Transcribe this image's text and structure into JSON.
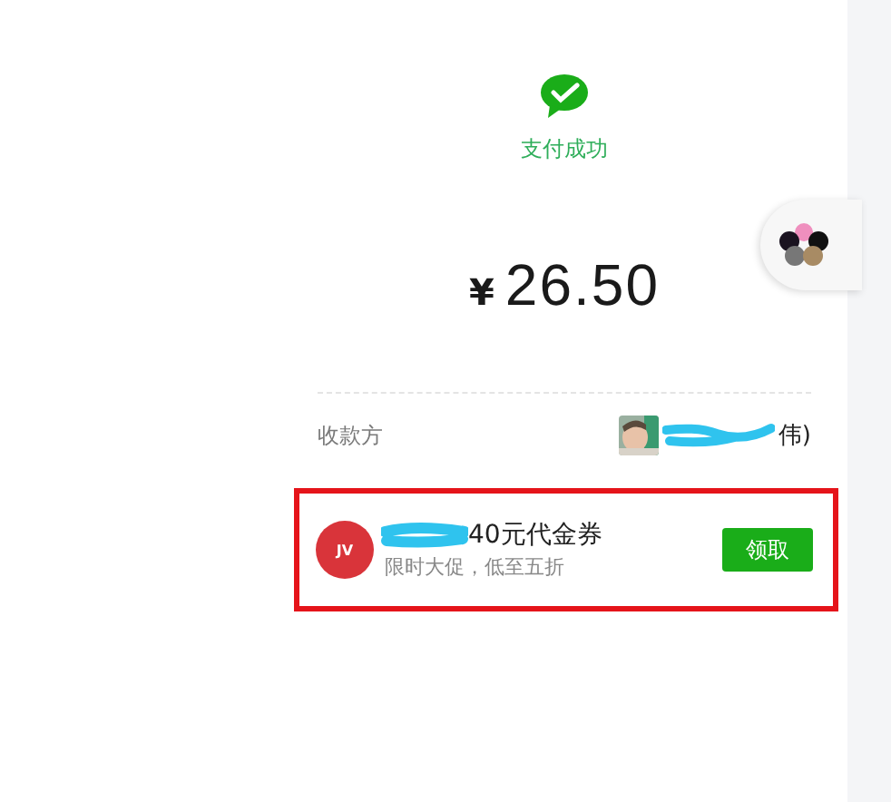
{
  "status": {
    "title": "支付成功"
  },
  "amount": {
    "currency": "¥",
    "value": "26.50"
  },
  "payee": {
    "label": "收款方",
    "name": "伟)"
  },
  "coupon": {
    "logo_text": "JV",
    "title": "40元代金券",
    "subtitle": "限时大促，低至五折",
    "button": "领取"
  }
}
